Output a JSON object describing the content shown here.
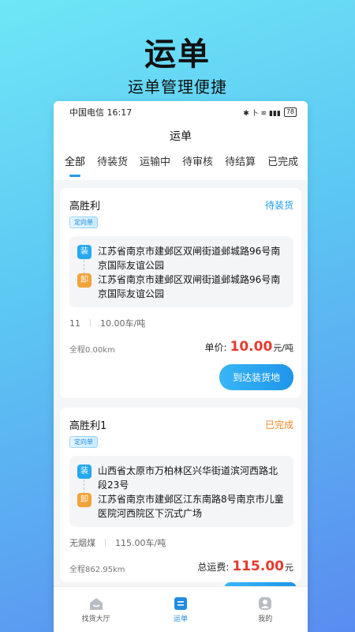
{
  "hero": {
    "title": "运单",
    "subtitle": "运单管理便捷"
  },
  "statusbar": {
    "carrier_time": "中国电信 16:17",
    "icons": "✱ 卜 ≋ ▮▮▮",
    "battery": "78"
  },
  "navbar": {
    "title": "运单"
  },
  "tabs": [
    "全部",
    "待装货",
    "运输中",
    "待审核",
    "待结算",
    "已完成"
  ],
  "orders": [
    {
      "shipper": "高胜利",
      "status": "待装货",
      "badge": "定向单",
      "load_icon": "装",
      "load_address": "江苏省南京市建邺区双闸街道邺城路96号南京国际友谊公园",
      "unload_icon": "卸",
      "unload_address": "江苏省南京市建邺区双闸街道邺城路96号南京国际友谊公园",
      "cargo": "11",
      "rate": "10.00车/吨",
      "distance": "全程0.00km",
      "price_label": "单价:",
      "price": "10.00",
      "price_unit": "元/吨",
      "action": "到达装货地"
    },
    {
      "shipper": "高胜利1",
      "status": "已完成",
      "badge": "定向单",
      "load_icon": "装",
      "load_address": "山西省太原市万柏林区兴华街道滨河西路北段23号",
      "unload_icon": "卸",
      "unload_address": "江苏省南京市建邺区江东南路8号南京市儿童医院河西院区下沉式广场",
      "cargo": "无烟煤",
      "rate": "115.00车/吨",
      "distance": "全程862.95km",
      "price_label": "总运费:",
      "price": "115.00",
      "price_unit": "元"
    }
  ],
  "bottom_nav": [
    {
      "label": "找货大厅",
      "icon": "house-icon"
    },
    {
      "label": "运单",
      "icon": "waybill-icon"
    },
    {
      "label": "我的",
      "icon": "person-icon"
    }
  ],
  "colors": {
    "accent": "#1f9be9",
    "price": "#e63a2e",
    "done": "#f08a24"
  }
}
